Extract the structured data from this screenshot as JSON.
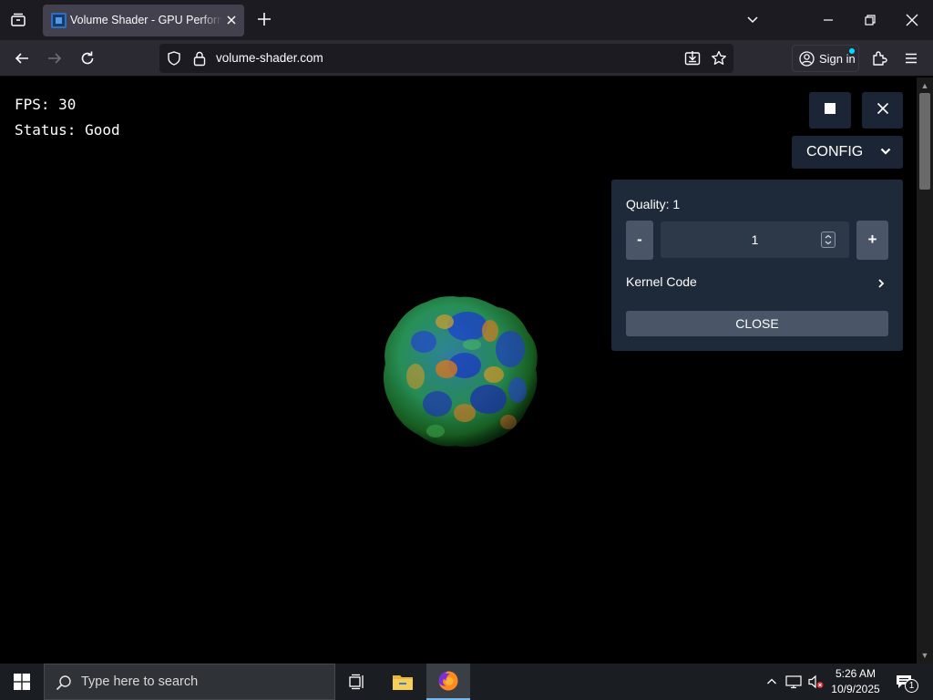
{
  "browser": {
    "tab": {
      "title": "Volume Shader - GPU Performance Test"
    },
    "url": "volume-shader.com",
    "sign_in_label": "Sign in"
  },
  "page": {
    "fps_text": "FPS: 30",
    "status_text": "Status: Good",
    "config_label": "CONFIG",
    "panel": {
      "quality_label": "Quality: 1",
      "minus_label": "-",
      "plus_label": "+",
      "quality_value": "1",
      "kernel_code_label": "Kernel Code",
      "close_label": "CLOSE"
    }
  },
  "taskbar": {
    "search_placeholder": "Type here to search",
    "time": "5:26 AM",
    "date": "10/9/2025",
    "notification_count": "1"
  },
  "colors": {
    "panel_bg": "#1e2939",
    "button_bg": "#1c2535",
    "accent": "#4a5568"
  }
}
